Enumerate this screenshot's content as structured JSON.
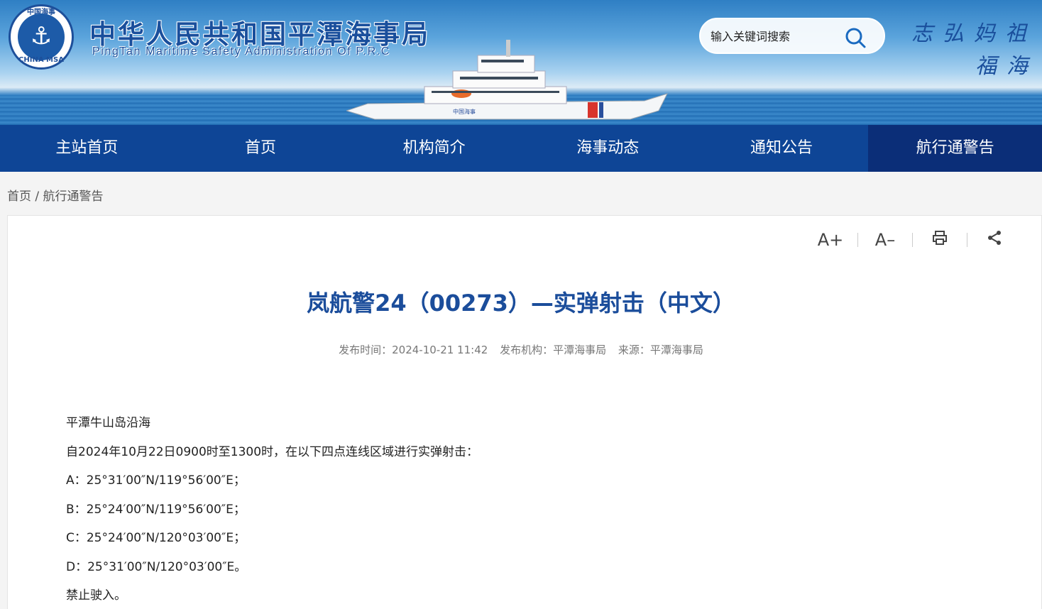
{
  "header": {
    "title": "中华人民共和国平潭海事局",
    "subtitle": "PingTan Maritime Safety Administration Of P.R.C",
    "logo_top_text": "中国海事",
    "logo_bottom_text": "CHINA MSA",
    "search_placeholder": "输入关键词搜索",
    "slogan_line1": "志弘妈祖",
    "slogan_line2": "福海"
  },
  "nav": {
    "items": [
      {
        "label": "主站首页"
      },
      {
        "label": "首页"
      },
      {
        "label": "机构简介"
      },
      {
        "label": "海事动态"
      },
      {
        "label": "通知公告"
      },
      {
        "label": "航行通警告"
      }
    ],
    "active_index": 5
  },
  "breadcrumb": {
    "home": "首页",
    "separator": "/",
    "current": "航行通警告"
  },
  "tools": {
    "font_increase": "A+",
    "font_decrease": "A–"
  },
  "article": {
    "title": "岚航警24（00273）—实弹射击（中文）",
    "publish_time": "发布时间：2024-10-21 11:42",
    "publisher": "发布机构：平潭海事局",
    "source": "来源：平潭海事局",
    "paragraphs": [
      "平潭牛山岛沿海",
      "自2024年10月22日0900时至1300时，在以下四点连线区域进行实弹射击：",
      "A：25°31′00″N/119°56′00″E；",
      "B：25°24′00″N/119°56′00″E；",
      "C：25°24′00″N/120°03′00″E；",
      "D：25°31′00″N/120°03′00″E。",
      "禁止驶入。"
    ]
  },
  "colors": {
    "nav_bg": "#0e4596",
    "nav_active_bg": "#0b2e78",
    "title_blue": "#1b4d9b"
  }
}
